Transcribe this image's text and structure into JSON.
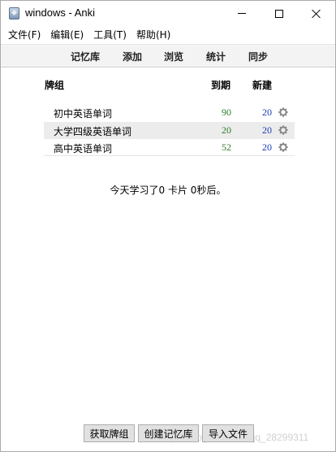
{
  "window": {
    "title": "windows - Anki"
  },
  "menu": [
    {
      "label": "文件(F)"
    },
    {
      "label": "编辑(E)"
    },
    {
      "label": "工具(T)"
    },
    {
      "label": "帮助(H)"
    }
  ],
  "toolbar": {
    "decks": "记忆库",
    "add": "添加",
    "browse": "浏览",
    "stats": "统计",
    "sync": "同步"
  },
  "deck_table": {
    "headers": {
      "name": "牌组",
      "due": "到期",
      "new": "新建"
    },
    "rows": [
      {
        "name": "初中英语单词",
        "due": "90",
        "new": "20",
        "icon": "gear-icon"
      },
      {
        "name": "大学四级英语单词",
        "due": "20",
        "new": "20",
        "icon": "gear-icon"
      },
      {
        "name": "高中英语单词",
        "due": "52",
        "new": "20",
        "icon": "gear-icon"
      }
    ]
  },
  "studied_today": "今天学习了0 卡片 0秒后。",
  "buttons": {
    "get_shared": "获取牌组",
    "create_deck": "创建记忆库",
    "import_file": "导入文件"
  },
  "watermark": "https://blog.csdn.net/qq_28299311",
  "colors": {
    "due": "#2c7d2c",
    "new": "#1a3cb3",
    "toolbar_bg": "#f3f3f3",
    "selected_row": "#ececec"
  }
}
